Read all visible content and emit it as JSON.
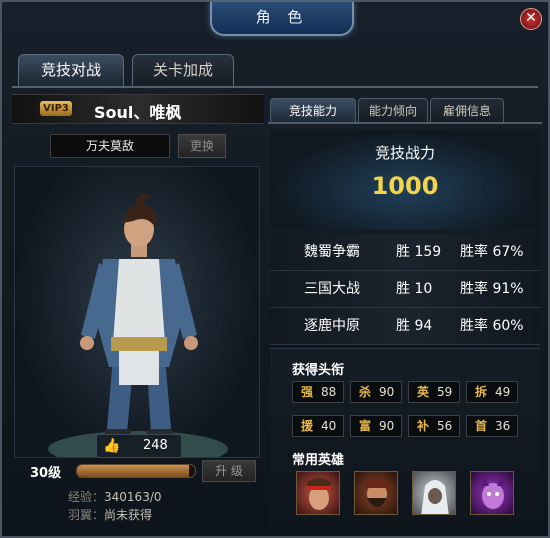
{
  "window": {
    "title": "角 色"
  },
  "tabs": [
    {
      "label": "竞技对战",
      "active": true
    },
    {
      "label": "关卡加成",
      "active": false
    }
  ],
  "player": {
    "vip": "VIP3",
    "name": "Soul、唯枫",
    "title": "万夫莫敌",
    "change_label": "更换",
    "likes": "248",
    "level": "30级",
    "exp_fraction": 0.95,
    "upgrade_label": "升 级",
    "exp_label": "经验：",
    "exp_value": "340163/0",
    "wing_label": "羽翼：",
    "wing_value": "尚未获得"
  },
  "sub_tabs": [
    {
      "label": "竞技能力",
      "active": true
    },
    {
      "label": "能力倾向",
      "active": false
    },
    {
      "label": "雇佣信息",
      "active": false
    }
  ],
  "power": {
    "label": "竞技战力",
    "value": "1000"
  },
  "stats": [
    {
      "mode": "魏蜀争霸",
      "win": "胜 159",
      "rate": "胜率 67%"
    },
    {
      "mode": "三国大战",
      "win": "胜 10",
      "rate": "胜率 91%"
    },
    {
      "mode": "逐鹿中原",
      "win": "胜 94",
      "rate": "胜率 60%"
    }
  ],
  "honors_title": "获得头衔",
  "honors": [
    {
      "char": "强",
      "value": "88"
    },
    {
      "char": "杀",
      "value": "90"
    },
    {
      "char": "英",
      "value": "59"
    },
    {
      "char": "拆",
      "value": "49"
    },
    {
      "char": "援",
      "value": "40"
    },
    {
      "char": "富",
      "value": "90"
    },
    {
      "char": "补",
      "value": "56"
    },
    {
      "char": "首",
      "value": "36"
    }
  ],
  "heroes_title": "常用英雄",
  "heroes": [
    {
      "icon": "hero-red-headband-icon"
    },
    {
      "icon": "hero-bearded-warrior-icon"
    },
    {
      "icon": "hero-hooded-assassin-icon"
    },
    {
      "icon": "hero-purple-demon-icon"
    }
  ]
}
